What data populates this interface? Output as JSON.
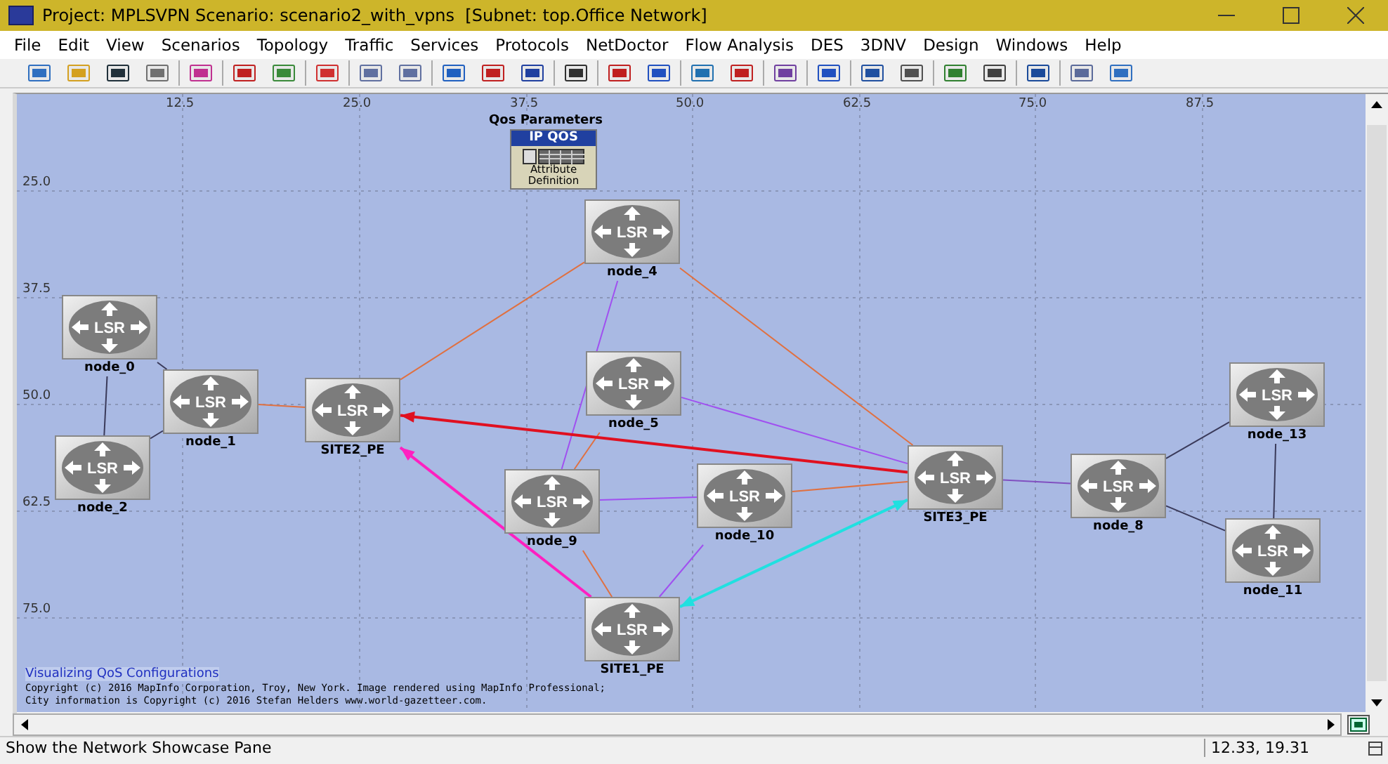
{
  "window": {
    "title": "Project: MPLSVPN Scenario: scenario2_with_vpns  [Subnet: top.Office Network]"
  },
  "menu": [
    "File",
    "Edit",
    "View",
    "Scenarios",
    "Topology",
    "Traffic",
    "Services",
    "Protocols",
    "NetDoctor",
    "Flow Analysis",
    "DES",
    "3DNV",
    "Design",
    "Windows",
    "Help"
  ],
  "canvas": {
    "x_ticks": [
      "12.5",
      "25.0",
      "37.5",
      "50.0",
      "62.5",
      "75.0",
      "87.5"
    ],
    "y_ticks": [
      "25.0",
      "37.5",
      "50.0",
      "62.5",
      "75.0"
    ],
    "qos_object": {
      "caption": "Qos Parameters",
      "header": "IP QOS",
      "label": "Attribute Definition"
    },
    "nodes": [
      {
        "name": "node_4",
        "badge": "LSR"
      },
      {
        "name": "node_0",
        "badge": "LSR"
      },
      {
        "name": "node_1",
        "badge": "LSR"
      },
      {
        "name": "SITE2_PE",
        "badge": "LSR"
      },
      {
        "name": "node_5",
        "badge": "LSR"
      },
      {
        "name": "node_13",
        "badge": "LSR"
      },
      {
        "name": "node_2",
        "badge": "LSR"
      },
      {
        "name": "SITE3_PE",
        "badge": "LSR"
      },
      {
        "name": "node_8",
        "badge": "LSR"
      },
      {
        "name": "node_9",
        "badge": "LSR"
      },
      {
        "name": "node_10",
        "badge": "LSR"
      },
      {
        "name": "node_11",
        "badge": "LSR"
      },
      {
        "name": "SITE1_PE",
        "badge": "LSR"
      }
    ],
    "caption": "Visualizing QoS Configurations",
    "copyright": [
      "Copyright (c) 2016 MapInfo Corporation, Troy, New York. Image rendered using MapInfo Professional;",
      "City information is Copyright (c) 2016 Stefan Helders www.world-gazetteer.com."
    ]
  },
  "status_bar": {
    "message": "Show the Network Showcase Pane",
    "coordinates": "12.33, 19.31"
  }
}
